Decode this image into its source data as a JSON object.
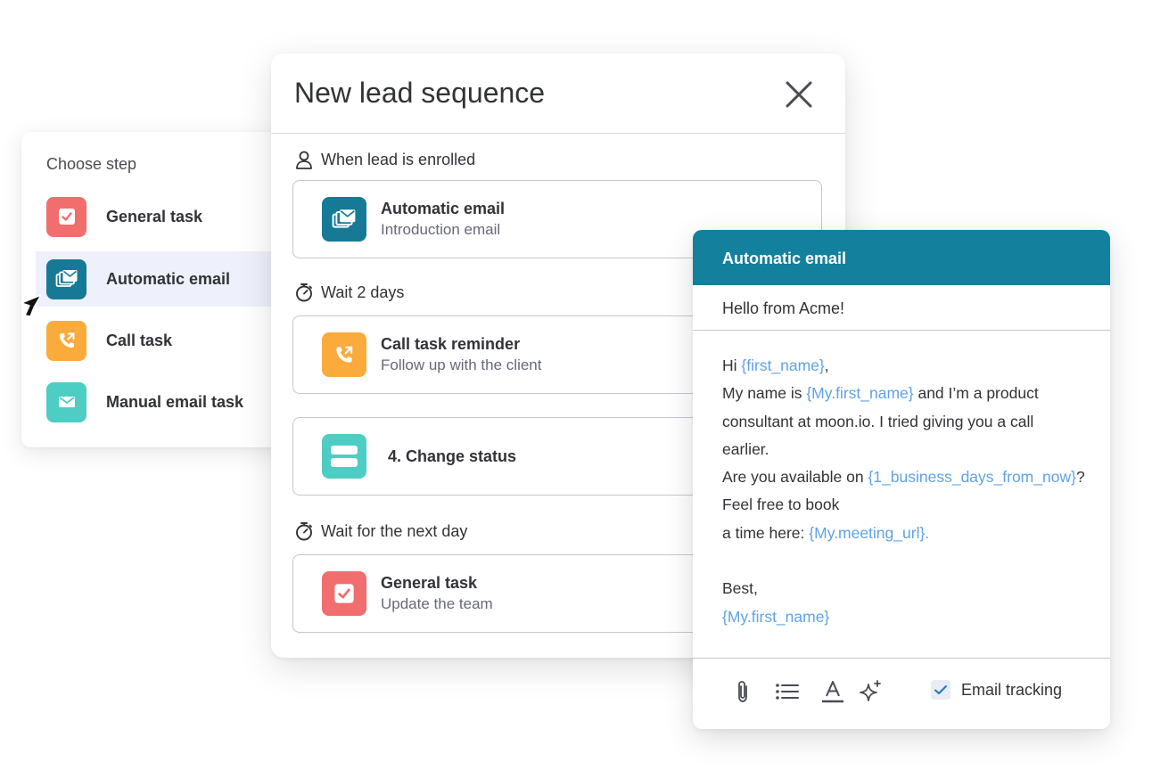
{
  "choose_step": {
    "title": "Choose step",
    "items": [
      {
        "label": "General task",
        "icon": "checkbox-icon",
        "color": "#f26d6d"
      },
      {
        "label": "Automatic email",
        "icon": "email-stack-icon",
        "color": "#167a96",
        "selected": true
      },
      {
        "label": "Call task",
        "icon": "phone-icon",
        "color": "#fbab3c"
      },
      {
        "label": "Manual email task",
        "icon": "envelope-icon",
        "color": "#4ecdc4"
      }
    ]
  },
  "sequence": {
    "title": "New lead sequence",
    "close_icon": "close-icon",
    "sections": [
      {
        "label": "When lead is enrolled",
        "icon": "person-icon"
      },
      {
        "label": "Wait 2 days",
        "icon": "stopwatch-icon"
      },
      {
        "label": "Wait for the next day",
        "icon": "stopwatch-icon"
      }
    ],
    "cards": [
      {
        "title": "Automatic email",
        "subtitle": "Introduction email",
        "icon": "email-stack-icon",
        "color": "#167a96"
      },
      {
        "title": "Call task reminder",
        "subtitle": "Follow up with the client",
        "icon": "phone-icon",
        "color": "#fbab3c"
      },
      {
        "title": "4. Change status",
        "icon": "status-icon",
        "color": "#4ecdc4"
      },
      {
        "title": "General task",
        "subtitle": "Update the team",
        "icon": "checkbox-icon",
        "color": "#f26d6d"
      }
    ]
  },
  "email_editor": {
    "header": "Automatic email",
    "subject": "Hello from Acme!",
    "body": {
      "l1_a": "Hi ",
      "l1_var": "{first_name}",
      "l1_b": ",",
      "l2_a": "My name is ",
      "l2_var": "{My.first_name}",
      "l2_b": " and I’m a product",
      "l3": "consultant at moon.io. I tried giving you a call",
      "l4": "earlier.",
      "l5_a": "Are you available on ",
      "l5_var": "{1_business_days_from_now}",
      "l5_b": "?",
      "l6": "Feel free to book",
      "l7_a": "a time here: ",
      "l7_var": "{My.meeting_url}.",
      "l9": "Best,",
      "l10_var": "{My.first_name}"
    },
    "toolbar": {
      "icons": [
        "paperclip-icon",
        "list-icon",
        "text-color-icon",
        "sparkle-icon"
      ],
      "tracking_label": "Email tracking",
      "tracking_checked": true
    },
    "accent_color": "#13809d",
    "variable_color": "#5fa3e6"
  }
}
